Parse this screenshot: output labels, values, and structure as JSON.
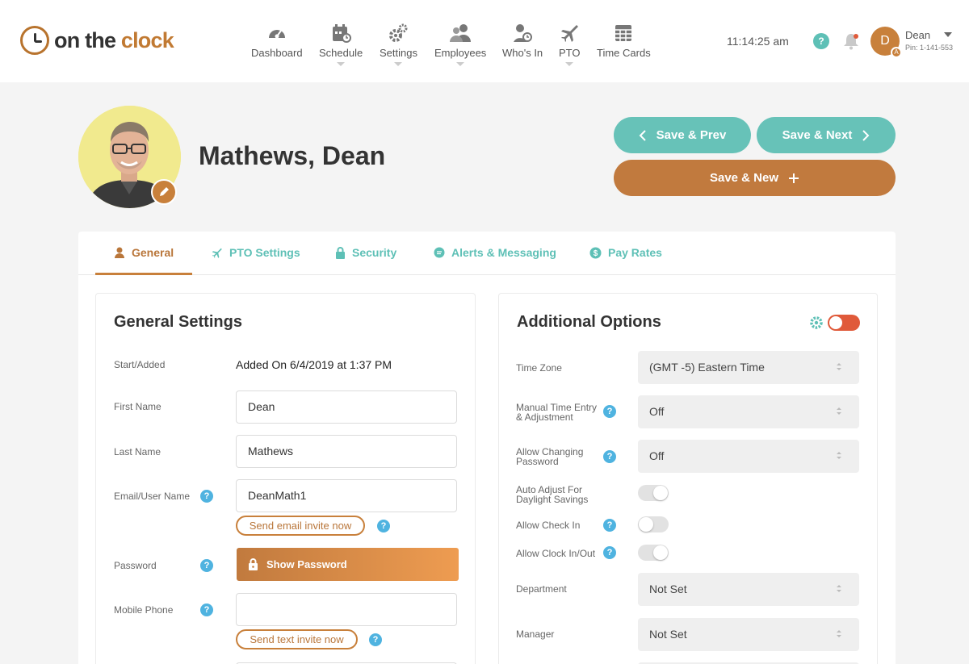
{
  "brand": {
    "on": "on the ",
    "clock": "clock"
  },
  "nav": [
    {
      "label": "Dashboard",
      "icon": "dashboard-icon"
    },
    {
      "label": "Schedule",
      "icon": "calendar-icon"
    },
    {
      "label": "Settings",
      "icon": "gears-icon"
    },
    {
      "label": "Employees",
      "icon": "users-icon"
    },
    {
      "label": "Who's In",
      "icon": "whos-in-icon"
    },
    {
      "label": "PTO",
      "icon": "plane-icon"
    },
    {
      "label": "Time Cards",
      "icon": "timecard-icon"
    }
  ],
  "header": {
    "time": "11:14:25 am",
    "help": "?",
    "user_initial": "D",
    "user_badge": "A",
    "user_name": "Dean",
    "user_pin": "Pin: 1-141-553"
  },
  "profile": {
    "name": "Mathews, Dean"
  },
  "actions": {
    "prev": "Save & Prev",
    "next": "Save & Next",
    "new": "Save & New"
  },
  "tabs": [
    {
      "label": "General",
      "icon": "person-icon",
      "active": true
    },
    {
      "label": "PTO Settings",
      "icon": "plane-icon"
    },
    {
      "label": "Security",
      "icon": "lock-icon"
    },
    {
      "label": "Alerts & Messaging",
      "icon": "chat-icon"
    },
    {
      "label": "Pay Rates",
      "icon": "dollar-icon"
    }
  ],
  "general": {
    "title": "General Settings",
    "start_label": "Start/Added",
    "start_value": "Added On 6/4/2019 at 1:37 PM",
    "first_name_label": "First Name",
    "first_name": "Dean",
    "last_name_label": "Last Name",
    "last_name": "Mathews",
    "email_label": "Email/User Name",
    "email": "DeanMath1",
    "send_email": "Send email invite now",
    "password_label": "Password",
    "show_password": "Show Password",
    "mobile_label": "Mobile Phone",
    "mobile": "",
    "send_text": "Send text invite now"
  },
  "additional": {
    "title": "Additional Options",
    "timezone_label": "Time Zone",
    "timezone": "(GMT -5) Eastern Time",
    "manual_label_1": "Manual Time Entry",
    "manual_label_2": "& Adjustment",
    "manual": "Off",
    "allow_pw_label_1": "Allow Changing",
    "allow_pw_label_2": "Password",
    "allow_pw": "Off",
    "dst_label_1": "Auto Adjust For",
    "dst_label_2": "Daylight Savings",
    "dst_on": true,
    "checkin_label": "Allow Check In",
    "checkin_on": false,
    "clockinout_label": "Allow Clock In/Out",
    "clockinout_on": true,
    "department_label": "Department",
    "department": "Not Set",
    "manager_label": "Manager",
    "manager": "Not Set"
  },
  "colors": {
    "teal": "#67c2b8",
    "brand": "#c17a3e",
    "help": "#4fb3e0",
    "toggle_red": "#e05a3a"
  }
}
